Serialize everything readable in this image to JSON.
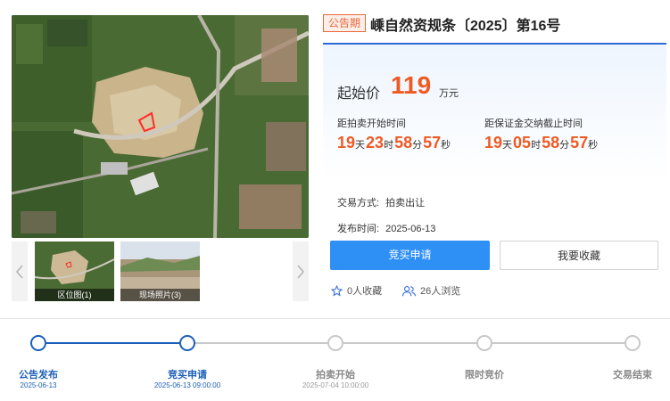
{
  "gallery": {
    "thumbnails": [
      {
        "label": "区位图(1)"
      },
      {
        "label": "现场照片(3)"
      }
    ]
  },
  "listing": {
    "badge": "公告期",
    "title": "嵊自然资规条〔2025〕第16号"
  },
  "price": {
    "label": "起始价",
    "value": "119",
    "unit": "万元"
  },
  "countdowns": [
    {
      "label": "距拍卖开始时间",
      "days": "19",
      "hours": "23",
      "minutes": "58",
      "seconds": "57"
    },
    {
      "label": "距保证金交纳截止时间",
      "days": "19",
      "hours": "05",
      "minutes": "58",
      "seconds": "57"
    }
  ],
  "countdown_units": {
    "days": "天",
    "hours": "时",
    "minutes": "分",
    "seconds": "秒"
  },
  "meta": {
    "trade_label": "交易方式:",
    "trade_value": "拍卖出让",
    "publish_label": "发布时间:",
    "publish_value": "2025-06-13"
  },
  "actions": {
    "apply": "竞买申请",
    "favorite": "我要收藏"
  },
  "stats": {
    "favorites": "0人收藏",
    "views": "26人浏览"
  },
  "timeline": [
    {
      "name": "公告发布",
      "date": "2025-06-13",
      "done": true
    },
    {
      "name": "竞买申请",
      "date": "2025-06-13 09:00:00",
      "done": true
    },
    {
      "name": "拍卖开始",
      "date": "2025-07-04 10:00:00",
      "done": false
    },
    {
      "name": "限时竞价",
      "date": "",
      "done": false
    },
    {
      "name": "交易结束",
      "date": "",
      "done": false
    }
  ],
  "colors": {
    "accent": "#2e8ff5",
    "price": "#ee5a24",
    "progress_done": "#1d5fb8",
    "progress_pending": "#c8c8c8"
  }
}
